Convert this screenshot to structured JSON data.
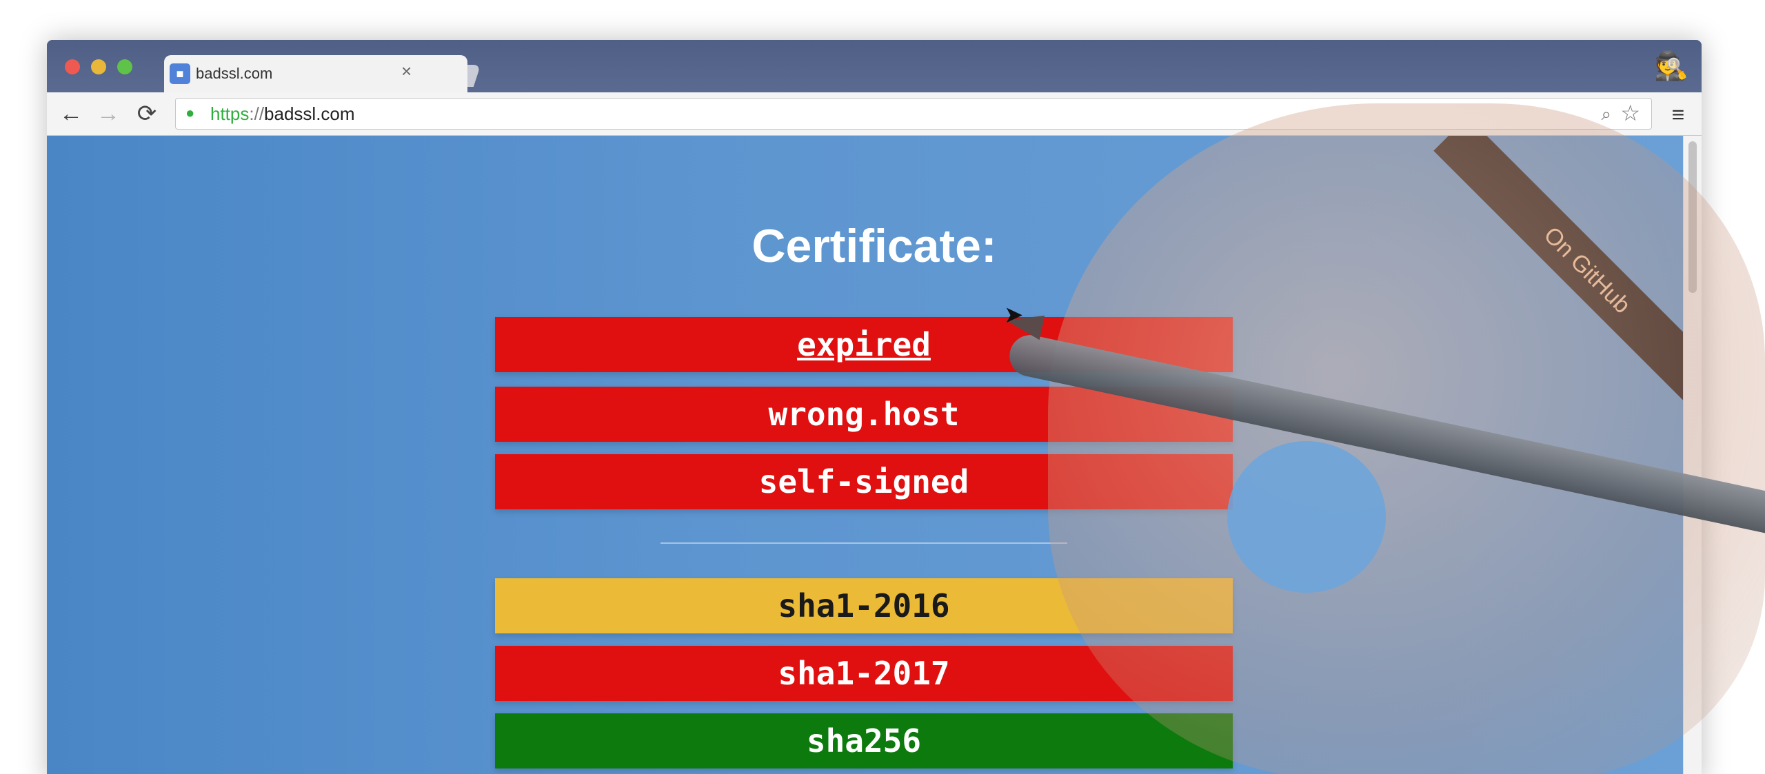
{
  "browser": {
    "tab": {
      "title": "badssl.com",
      "close": "×",
      "favicon": "lock-icon"
    },
    "omnibox": {
      "scheme": "https",
      "separator": "://",
      "host": "badssl.com"
    },
    "nav": {
      "back": "←",
      "forward": "→",
      "reload": "⟳"
    },
    "icons": {
      "zoom": "⌕",
      "star": "☆",
      "menu": "≡",
      "incognito": "🕵"
    }
  },
  "page": {
    "heading": "Certificate:",
    "ribbon": "On GitHub",
    "tests": [
      {
        "label": "expired",
        "color": "#e01010"
      },
      {
        "label": "wrong.host",
        "color": "#e01010"
      },
      {
        "label": "self-signed",
        "color": "#e01010"
      },
      {
        "label": "sha1-2016",
        "color": "#ebbb37"
      },
      {
        "label": "sha1-2017",
        "color": "#e01010"
      },
      {
        "label": "sha256",
        "color": "#0d7a0d"
      }
    ]
  },
  "colors": {
    "page_bg": "#5a95d0",
    "error_red": "#e01010",
    "warning_yellow": "#ebbb37",
    "ok_green": "#0d7a0d",
    "secure_green": "#2fae3d"
  }
}
